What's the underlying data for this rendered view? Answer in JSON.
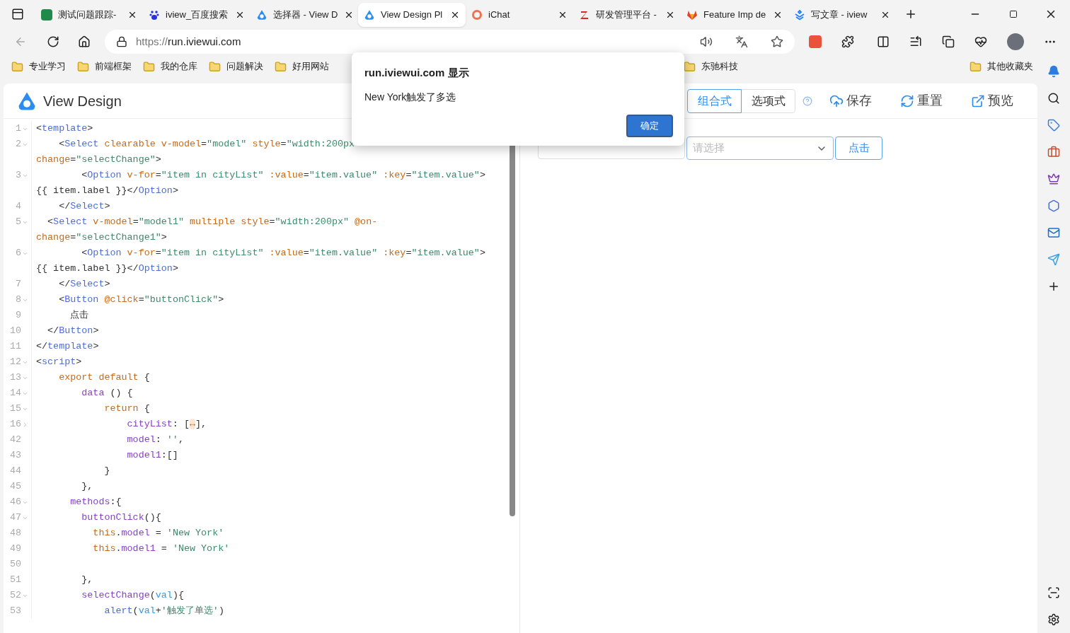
{
  "tabs": [
    {
      "title": "测试问题跟踪-",
      "selected": false
    },
    {
      "title": "iview_百度搜索",
      "selected": false
    },
    {
      "title": "选择器 - View D",
      "selected": false
    },
    {
      "title": "View Design Pl",
      "selected": true
    },
    {
      "title": "iChat",
      "selected": false
    },
    {
      "title": "研发管理平台 -",
      "selected": false
    },
    {
      "title": "Feature Imp de",
      "selected": false
    },
    {
      "title": "写文章 - iview",
      "selected": false
    }
  ],
  "address": {
    "scheme": "https://",
    "host": "run.iviewui.com"
  },
  "bookmarks": [
    "专业学习",
    "前端框架",
    "我的仓库",
    "问题解决",
    "好用网站",
    "东驰科技"
  ],
  "other_bookmarks": "其他收藏夹",
  "app": {
    "title": "View Design",
    "modes": [
      {
        "label": "组合式",
        "selected": true
      },
      {
        "label": "选项式",
        "selected": false
      }
    ],
    "actions": [
      "保存",
      "重置",
      "预览"
    ]
  },
  "code": [
    {
      "number": "1",
      "expanded": true,
      "tokens": [
        {
          "kind": "punct",
          "text": "<"
        },
        {
          "kind": "tag",
          "text": "template"
        },
        {
          "kind": "punct",
          "text": ">"
        }
      ]
    },
    {
      "number": "2",
      "expanded": true,
      "tokens": [
        {
          "kind": "punct",
          "text": "    <"
        },
        {
          "kind": "tag",
          "text": "Select"
        },
        {
          "kind": "attr",
          "text": " clearable v-model"
        },
        {
          "kind": "punct",
          "text": "="
        },
        {
          "kind": "str",
          "text": "\"model\""
        },
        {
          "kind": "attr",
          "text": " style"
        },
        {
          "kind": "punct",
          "text": "="
        },
        {
          "kind": "str",
          "text": "\"width:200px"
        }
      ]
    },
    {
      "tokens": [
        {
          "kind": "attr",
          "text": "change"
        },
        {
          "kind": "punct",
          "text": "="
        },
        {
          "kind": "str",
          "text": "\"selectChange\""
        },
        {
          "kind": "punct",
          "text": ">"
        }
      ]
    },
    {
      "number": "3",
      "expanded": true,
      "tokens": [
        {
          "kind": "punct",
          "text": "        <"
        },
        {
          "kind": "tag",
          "text": "Option"
        },
        {
          "kind": "attr",
          "text": " v-for"
        },
        {
          "kind": "punct",
          "text": "="
        },
        {
          "kind": "str",
          "text": "\"item in cityList\""
        },
        {
          "kind": "attr",
          "text": " :value"
        },
        {
          "kind": "punct",
          "text": "="
        },
        {
          "kind": "str",
          "text": "\"item.value\""
        },
        {
          "kind": "attr",
          "text": " :key"
        },
        {
          "kind": "punct",
          "text": "="
        },
        {
          "kind": "str",
          "text": "\"item.value\""
        },
        {
          "kind": "punct",
          "text": ">"
        }
      ]
    },
    {
      "tokens": [
        {
          "kind": "punct",
          "text": "{{ item.label }}</"
        },
        {
          "kind": "tag",
          "text": "Option"
        },
        {
          "kind": "punct",
          "text": ">"
        }
      ]
    },
    {
      "number": "4",
      "tokens": [
        {
          "kind": "punct",
          "text": "    </"
        },
        {
          "kind": "tag",
          "text": "Select"
        },
        {
          "kind": "punct",
          "text": ">"
        }
      ]
    },
    {
      "number": "5",
      "expanded": true,
      "tokens": [
        {
          "kind": "punct",
          "text": "  <"
        },
        {
          "kind": "tag",
          "text": "Select"
        },
        {
          "kind": "attr",
          "text": " v-model"
        },
        {
          "kind": "punct",
          "text": "="
        },
        {
          "kind": "str",
          "text": "\"model1\""
        },
        {
          "kind": "attr",
          "text": " multiple style"
        },
        {
          "kind": "punct",
          "text": "="
        },
        {
          "kind": "str",
          "text": "\"width:200px\""
        },
        {
          "kind": "attr",
          "text": " @on-"
        }
      ]
    },
    {
      "tokens": [
        {
          "kind": "attr",
          "text": "change"
        },
        {
          "kind": "punct",
          "text": "="
        },
        {
          "kind": "str",
          "text": "\"selectChange1\""
        },
        {
          "kind": "punct",
          "text": ">"
        }
      ]
    },
    {
      "number": "6",
      "expanded": true,
      "tokens": [
        {
          "kind": "punct",
          "text": "        <"
        },
        {
          "kind": "tag",
          "text": "Option"
        },
        {
          "kind": "attr",
          "text": " v-for"
        },
        {
          "kind": "punct",
          "text": "="
        },
        {
          "kind": "str",
          "text": "\"item in cityList\""
        },
        {
          "kind": "attr",
          "text": " :value"
        },
        {
          "kind": "punct",
          "text": "="
        },
        {
          "kind": "str",
          "text": "\"item.value\""
        },
        {
          "kind": "attr",
          "text": " :key"
        },
        {
          "kind": "punct",
          "text": "="
        },
        {
          "kind": "str",
          "text": "\"item.value\""
        },
        {
          "kind": "punct",
          "text": ">"
        }
      ]
    },
    {
      "tokens": [
        {
          "kind": "punct",
          "text": "{{ item.label }}</"
        },
        {
          "kind": "tag",
          "text": "Option"
        },
        {
          "kind": "punct",
          "text": ">"
        }
      ]
    },
    {
      "number": "7",
      "tokens": [
        {
          "kind": "punct",
          "text": "    </"
        },
        {
          "kind": "tag",
          "text": "Select"
        },
        {
          "kind": "punct",
          "text": ">"
        }
      ]
    },
    {
      "number": "8",
      "expanded": true,
      "tokens": [
        {
          "kind": "punct",
          "text": "    <"
        },
        {
          "kind": "tag",
          "text": "Button"
        },
        {
          "kind": "attr",
          "text": " @click"
        },
        {
          "kind": "punct",
          "text": "="
        },
        {
          "kind": "str",
          "text": "\"buttonClick\""
        },
        {
          "kind": "punct",
          "text": ">"
        }
      ]
    },
    {
      "number": "9",
      "tokens": [
        {
          "kind": "punct",
          "text": "      点击"
        }
      ]
    },
    {
      "number": "10",
      "tokens": [
        {
          "kind": "punct",
          "text": "  </"
        },
        {
          "kind": "tag",
          "text": "Button"
        },
        {
          "kind": "punct",
          "text": ">"
        }
      ]
    },
    {
      "number": "11",
      "tokens": [
        {
          "kind": "punct",
          "text": "</"
        },
        {
          "kind": "tag",
          "text": "template"
        },
        {
          "kind": "punct",
          "text": ">"
        }
      ]
    },
    {
      "number": "12",
      "expanded": true,
      "tokens": [
        {
          "kind": "punct",
          "text": "<"
        },
        {
          "kind": "tag",
          "text": "script"
        },
        {
          "kind": "punct",
          "text": ">"
        }
      ]
    },
    {
      "number": "13",
      "expanded": true,
      "tokens": [
        {
          "kind": "kw",
          "text": "    export default"
        },
        {
          "kind": "punct",
          "text": " {"
        }
      ]
    },
    {
      "number": "14",
      "expanded": true,
      "tokens": [
        {
          "kind": "prop",
          "text": "        data"
        },
        {
          "kind": "punct",
          "text": " () {"
        }
      ]
    },
    {
      "number": "15",
      "expanded": true,
      "tokens": [
        {
          "kind": "kw",
          "text": "            return"
        },
        {
          "kind": "punct",
          "text": " {"
        }
      ]
    },
    {
      "number": "16",
      "expanded": false,
      "tokens": [
        {
          "kind": "prop",
          "text": "                cityList"
        },
        {
          "kind": "punct",
          "text": ": ["
        },
        {
          "kind": "folded",
          "text": "↔"
        },
        {
          "kind": "punct",
          "text": "],"
        }
      ]
    },
    {
      "number": "42",
      "tokens": [
        {
          "kind": "prop",
          "text": "                model"
        },
        {
          "kind": "punct",
          "text": ": "
        },
        {
          "kind": "str",
          "text": "''"
        },
        {
          "kind": "punct",
          "text": ","
        }
      ]
    },
    {
      "number": "43",
      "tokens": [
        {
          "kind": "prop",
          "text": "                model1"
        },
        {
          "kind": "punct",
          "text": ":[]"
        }
      ]
    },
    {
      "number": "44",
      "tokens": [
        {
          "kind": "punct",
          "text": "            }"
        }
      ]
    },
    {
      "number": "45",
      "tokens": [
        {
          "kind": "punct",
          "text": "        },"
        }
      ]
    },
    {
      "number": "46",
      "expanded": true,
      "tokens": [
        {
          "kind": "prop",
          "text": "      methods"
        },
        {
          "kind": "punct",
          "text": ":{"
        }
      ]
    },
    {
      "number": "47",
      "expanded": true,
      "tokens": [
        {
          "kind": "prop",
          "text": "        buttonClick"
        },
        {
          "kind": "punct",
          "text": "(){"
        }
      ]
    },
    {
      "number": "48",
      "tokens": [
        {
          "kind": "kw",
          "text": "          this"
        },
        {
          "kind": "punct",
          "text": "."
        },
        {
          "kind": "prop",
          "text": "model"
        },
        {
          "kind": "punct",
          "text": " = "
        },
        {
          "kind": "str",
          "text": "'New York'"
        }
      ]
    },
    {
      "number": "49",
      "tokens": [
        {
          "kind": "kw",
          "text": "          this"
        },
        {
          "kind": "punct",
          "text": "."
        },
        {
          "kind": "prop",
          "text": "model1"
        },
        {
          "kind": "punct",
          "text": " = "
        },
        {
          "kind": "str",
          "text": "'New York'"
        }
      ]
    },
    {
      "number": "50"
    },
    {
      "number": "51",
      "tokens": [
        {
          "kind": "punct",
          "text": "        },"
        }
      ]
    },
    {
      "number": "52",
      "expanded": true,
      "tokens": [
        {
          "kind": "prop",
          "text": "        selectChange"
        },
        {
          "kind": "punct",
          "text": "("
        },
        {
          "kind": "param",
          "text": "val"
        },
        {
          "kind": "punct",
          "text": "){"
        }
      ]
    },
    {
      "number": "53",
      "tokens": [
        {
          "kind": "fn",
          "text": "            alert"
        },
        {
          "kind": "punct",
          "text": "("
        },
        {
          "kind": "param",
          "text": "val"
        },
        {
          "kind": "punct",
          "text": "+"
        },
        {
          "kind": "str",
          "text": "'触发了单选'"
        },
        {
          "kind": "punct",
          "text": ")"
        }
      ]
    }
  ],
  "preview": {
    "select_placeholder": "请选择",
    "button": "点击"
  },
  "dialog": {
    "title": "run.iviewui.com 显示",
    "message": "New York触发了多选",
    "ok": "确定"
  }
}
